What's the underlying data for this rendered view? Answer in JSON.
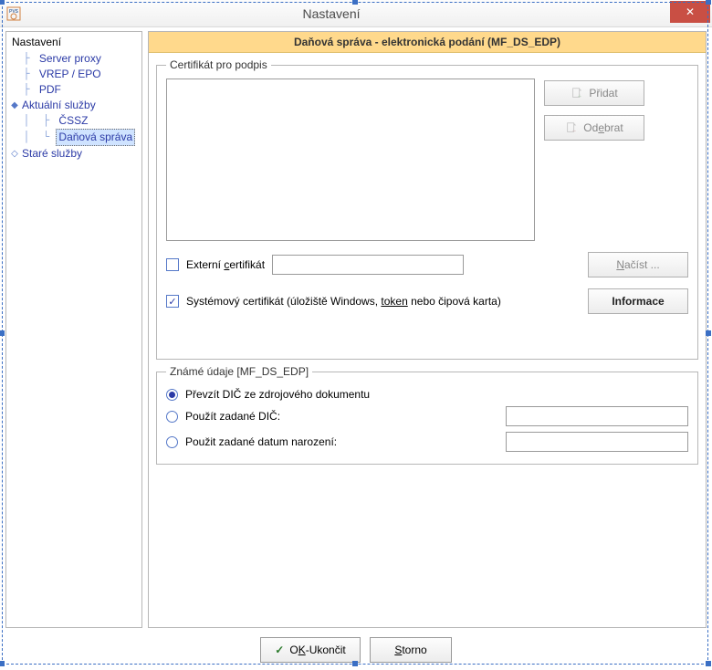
{
  "window": {
    "title": "Nastavení",
    "close_label": "✕"
  },
  "tree": {
    "root": "Nastavení",
    "items": [
      {
        "label": "Server proxy",
        "indent": 1
      },
      {
        "label": "VREP / EPO",
        "indent": 1
      },
      {
        "label": "PDF",
        "indent": 1
      },
      {
        "label": "Aktuální služby",
        "indent": 1,
        "expandable": true,
        "expanded": true
      },
      {
        "label": "ČSSZ",
        "indent": 2
      },
      {
        "label": "Daňová správa",
        "indent": 2,
        "selected": true
      },
      {
        "label": "Staré služby",
        "indent": 1,
        "expandable": true,
        "expanded": false
      }
    ]
  },
  "panel": {
    "header": "Daňová správa - elektronická podání (MF_DS_EDP)",
    "cert_group": "Certifikát pro podpis",
    "add_btn": "Přidat",
    "remove_btn": "Odebrat",
    "external_cert": "Externí certifikát",
    "load_btn": "Načíst ...",
    "system_cert_pre": "Systémový certifikát (úložiště Windows, ",
    "system_cert_token": "token",
    "system_cert_post": " nebo čipová karta)",
    "info_btn": "Informace",
    "known_group": "Známé údaje [MF_DS_EDP]",
    "radio1": "Převzít DIČ ze zdrojového dokumentu",
    "radio2": "Použít zadané DIČ:",
    "radio3": "Použit zadané datum narození:"
  },
  "buttons": {
    "ok_pre": "O",
    "ok_under": "K",
    "ok_post": "-Ukončit",
    "cancel_pre": "",
    "cancel_under": "S",
    "cancel_post": "torno"
  }
}
